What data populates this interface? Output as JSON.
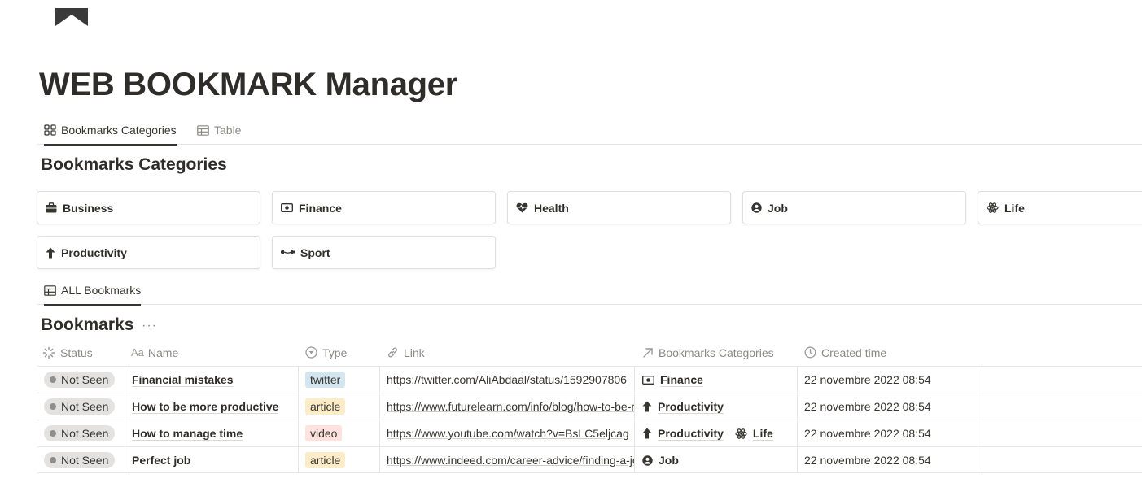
{
  "page": {
    "title": "WEB BOOKMARK Manager",
    "icon": "notion-page-icon"
  },
  "views_top": [
    {
      "label": "Bookmarks Categories",
      "icon": "gallery-icon",
      "active": true
    },
    {
      "label": "Table",
      "icon": "table-icon",
      "active": false
    }
  ],
  "categories_section": {
    "title": "Bookmarks Categories",
    "cards": [
      {
        "label": "Business",
        "icon": "briefcase-icon"
      },
      {
        "label": "Finance",
        "icon": "money-icon"
      },
      {
        "label": "Health",
        "icon": "heart-pulse-icon"
      },
      {
        "label": "Job",
        "icon": "person-icon"
      },
      {
        "label": "Life",
        "icon": "atom-icon"
      },
      {
        "label": "Productivity",
        "icon": "arrow-up-icon"
      },
      {
        "label": "Sport",
        "icon": "barbell-icon"
      }
    ]
  },
  "views_bottom": [
    {
      "label": "ALL Bookmarks",
      "icon": "table-icon",
      "active": true
    }
  ],
  "bookmarks_section": {
    "title": "Bookmarks",
    "more": "···",
    "columns": [
      {
        "label": "Status",
        "icon": "status-icon"
      },
      {
        "label": "Name",
        "icon": "text-aa-icon"
      },
      {
        "label": "Type",
        "icon": "select-icon"
      },
      {
        "label": "Link",
        "icon": "link-icon"
      },
      {
        "label": "Bookmarks Categories",
        "icon": "relation-arrow-icon"
      },
      {
        "label": "Created time",
        "icon": "clock-icon"
      }
    ],
    "rows": [
      {
        "status": "Not Seen",
        "name": "Financial mistakes",
        "type": "twitter",
        "link": "https://twitter.com/AliAbdaal/status/1592907806",
        "categories": [
          {
            "label": "Finance",
            "icon": "money-icon"
          }
        ],
        "created": "22 novembre 2022 08:54"
      },
      {
        "status": "Not Seen",
        "name": "How to be more productive",
        "type": "article",
        "link": "https://www.futurelearn.com/info/blog/how-to-be-more-productive",
        "categories": [
          {
            "label": "Productivity",
            "icon": "arrow-up-icon"
          }
        ],
        "created": "22 novembre 2022 08:54"
      },
      {
        "status": "Not Seen",
        "name": "How to manage time",
        "type": "video",
        "link": "https://www.youtube.com/watch?v=BsLC5eljcag",
        "categories": [
          {
            "label": "Productivity",
            "icon": "arrow-up-icon"
          },
          {
            "label": "Life",
            "icon": "atom-icon"
          }
        ],
        "created": "22 novembre 2022 08:54"
      },
      {
        "status": "Not Seen",
        "name": "Perfect job",
        "type": "article",
        "link": "https://www.indeed.com/career-advice/finding-a-job",
        "categories": [
          {
            "label": "Job",
            "icon": "person-icon"
          }
        ],
        "created": "22 novembre 2022 08:54"
      }
    ]
  },
  "colors": {
    "text": "#37352f",
    "muted": "#8a8985",
    "border": "#e6e6e4",
    "status_bg": "#e3e2e0",
    "tag_twitter": "#d3e5ef",
    "tag_article": "#fdecc8",
    "tag_video": "#ffe2dd"
  }
}
